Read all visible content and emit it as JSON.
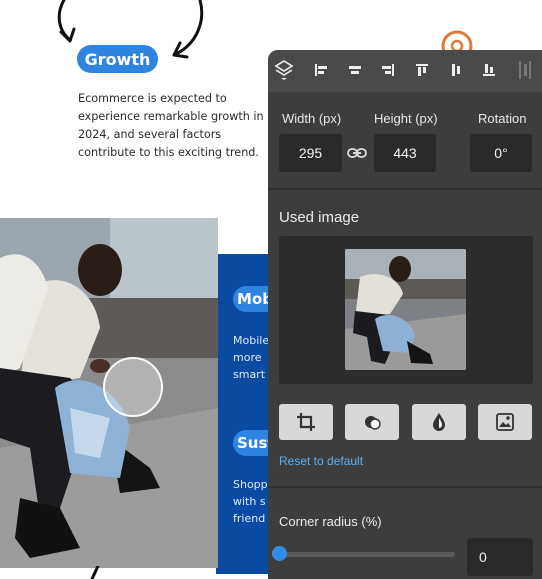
{
  "canvas": {
    "heading": "Growth",
    "body": "Ecommerce is expected to experience remarkable growth in 2024, and several factors contribute to this exciting trend.",
    "sections": [
      {
        "title": "Mobile",
        "text": "Mobile\nmore\nsmart"
      },
      {
        "title": "Sustain",
        "text": "Shopp\nwith s\nfriend"
      }
    ],
    "accent": "#2f84e0",
    "panel_blue": "#0a4aa0"
  },
  "toolbar": {
    "items": [
      {
        "name": "layers-icon"
      },
      {
        "name": "align-left-icon"
      },
      {
        "name": "align-center-horizontal-icon"
      },
      {
        "name": "align-right-icon"
      },
      {
        "name": "align-top-icon"
      },
      {
        "name": "align-middle-vertical-icon"
      },
      {
        "name": "align-bottom-icon"
      },
      {
        "name": "distribute-icon"
      }
    ]
  },
  "dimensions": {
    "width_label": "Width (px)",
    "width_value": "295",
    "height_label": "Height (px)",
    "height_value": "443",
    "rotation_label": "Rotation",
    "rotation_value": "0°",
    "link_icon": "link-icon"
  },
  "used_image": {
    "title": "Used image",
    "tools": [
      "crop-icon",
      "shape-mask-icon",
      "color-drop-icon",
      "image-replace-icon"
    ],
    "reset_label": "Reset to default"
  },
  "corner": {
    "label": "Corner radius (%)",
    "value": "0",
    "slider_fraction": 0
  }
}
